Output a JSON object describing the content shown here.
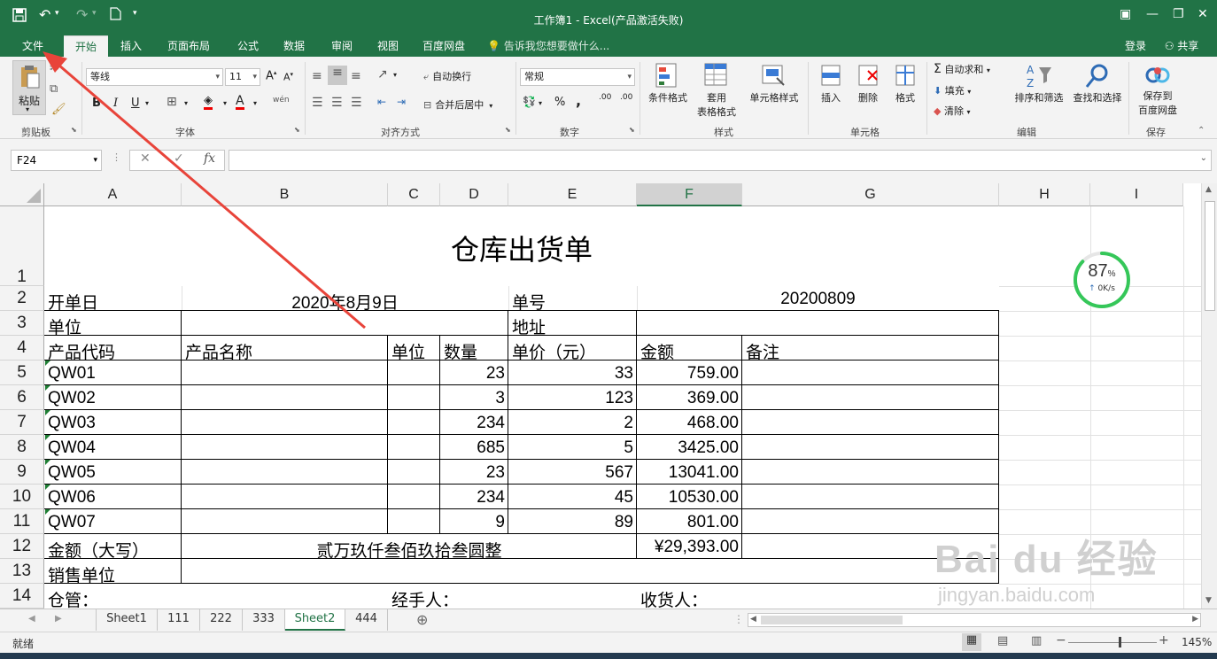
{
  "window": {
    "title": "工作簿1 - Excel(产品激活失败)"
  },
  "menu_tabs": [
    "文件",
    "开始",
    "插入",
    "页面布局",
    "公式",
    "数据",
    "审阅",
    "视图",
    "百度网盘"
  ],
  "tell_me": "告诉我您想要做什么...",
  "account": {
    "login": "登录",
    "share": "共享"
  },
  "ribbon": {
    "clipboard": {
      "paste": "粘贴",
      "group": "剪贴板"
    },
    "font": {
      "name": "等线",
      "size": "11",
      "group": "字体",
      "bold": "B",
      "italic": "I",
      "underline": "U",
      "phonetic": "wén"
    },
    "alignment": {
      "wrap": "自动换行",
      "merge": "合并后居中",
      "group": "对齐方式"
    },
    "number": {
      "format": "常规",
      "percent": "%",
      "comma": ",",
      "inc": ".00",
      "dec": ".00",
      "group": "数字"
    },
    "styles": {
      "cond": "条件格式",
      "table1": "套用",
      "table2": "表格格式",
      "cell": "单元格样式",
      "group": "样式"
    },
    "cells": {
      "insert": "插入",
      "delete": "删除",
      "format": "格式",
      "group": "单元格"
    },
    "editing": {
      "autosum": "自动求和",
      "fill": "填充",
      "clear": "清除",
      "sort": "排序和筛选",
      "find": "查找和选择",
      "group": "编辑"
    },
    "save": {
      "line1": "保存到",
      "line2": "百度网盘",
      "group": "保存"
    }
  },
  "formula_bar": {
    "name_box": "F24",
    "fx": "fx",
    "value": ""
  },
  "columns": [
    "A",
    "B",
    "C",
    "D",
    "E",
    "F",
    "G",
    "H",
    "I"
  ],
  "rows": [
    "1",
    "2",
    "3",
    "4",
    "5",
    "6",
    "7",
    "8",
    "9",
    "10",
    "11",
    "12",
    "13",
    "14"
  ],
  "sheet": {
    "title": "仓库出货单",
    "date_label": "开单日",
    "date_value": "2020年8月9日",
    "no_label": "单号",
    "no_value": "20200809",
    "unit_label": "单位",
    "addr_label": "地址",
    "headers": [
      "产品代码",
      "产品名称",
      "单位",
      "数量",
      "单价（元）",
      "金额",
      "备注"
    ],
    "items": [
      {
        "code": "QW01",
        "qty": "23",
        "price": "33",
        "amount": "759.00"
      },
      {
        "code": "QW02",
        "qty": "3",
        "price": "123",
        "amount": "369.00"
      },
      {
        "code": "QW03",
        "qty": "234",
        "price": "2",
        "amount": "468.00"
      },
      {
        "code": "QW04",
        "qty": "685",
        "price": "5",
        "amount": "3425.00"
      },
      {
        "code": "QW05",
        "qty": "23",
        "price": "567",
        "amount": "13041.00"
      },
      {
        "code": "QW06",
        "qty": "234",
        "price": "45",
        "amount": "10530.00"
      },
      {
        "code": "QW07",
        "qty": "9",
        "price": "89",
        "amount": "801.00"
      }
    ],
    "total_label": "金额（大写）",
    "total_words": "贰万玖仟叁佰玖拾叁圆整",
    "total_value": "¥29,393.00",
    "seller_label": "销售单位",
    "keeper_label": "仓管：",
    "handler_label": "经手人：",
    "receiver_label": "收货人："
  },
  "sheet_tabs": [
    "Sheet1",
    "111",
    "222",
    "333",
    "Sheet2",
    "444"
  ],
  "active_sheet": "Sheet2",
  "status": {
    "ready": "就绪",
    "zoom": "145%"
  },
  "speed_widget": {
    "percent": "87",
    "unit": "%",
    "rate": "0K/s"
  },
  "watermark": {
    "brand": "Bai du 经验",
    "url": "jingyan.baidu.com"
  },
  "colors": {
    "excel_green": "#217346",
    "arrow_red": "#e8443a",
    "speed_green": "#35c759"
  }
}
